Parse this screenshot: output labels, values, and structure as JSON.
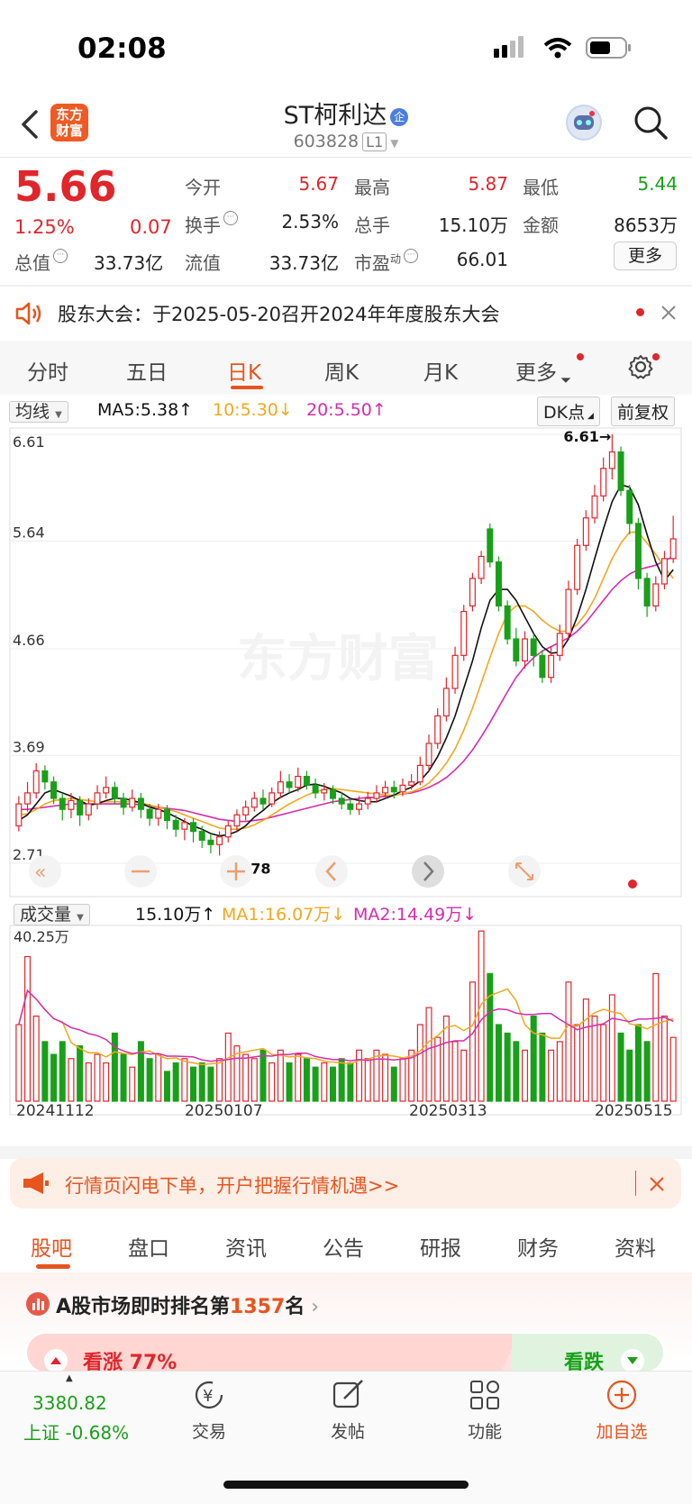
{
  "status": {
    "time": "02:08"
  },
  "header": {
    "logo_text": "东方财富",
    "title": "ST柯利达",
    "badge": "企",
    "code": "603828",
    "level": "L1"
  },
  "quote": {
    "price": "5.66",
    "change_pct": "1.25%",
    "change_val": "0.07",
    "open_label": "今开",
    "open": "5.67",
    "high_label": "最高",
    "high": "5.87",
    "low_label": "最低",
    "low": "5.44",
    "turnover_label": "换手",
    "turnover": "2.53%",
    "volume_label": "总手",
    "volume": "15.10万",
    "amount_label": "金额",
    "amount": "8653万",
    "mktcap_label": "总值",
    "mktcap": "33.73亿",
    "float_label": "流值",
    "float_cap": "33.73亿",
    "pe_label": "市盈",
    "pe_sup": "动",
    "pe": "66.01",
    "more_label": "更多"
  },
  "notice": {
    "text": "股东大会：于2025-05-20召开2024年年度股东大会"
  },
  "tabs": [
    "分时",
    "五日",
    "日K",
    "周K",
    "月K",
    "更多"
  ],
  "ma": {
    "select": "均线",
    "ma5": "MA5:5.38↑",
    "ma10": "10:5.30↓",
    "ma20": "20:5.50↑",
    "dk": "DK点",
    "fq": "前复权"
  },
  "vol_row": {
    "select": "成交量",
    "vol": "15.10万↑",
    "ma1": "MA1:16.07万↓",
    "ma2": "MA2:14.49万↓",
    "max_label": "40.25万"
  },
  "watermark": "东方财富",
  "chart_data": {
    "type": "candlestick",
    "y_ticks": [
      "6.61",
      "5.64",
      "4.66",
      "3.69",
      "2.71"
    ],
    "x_ticks": [
      "20241112",
      "20250107",
      "20250313",
      "20250515"
    ],
    "max_mark": "6.61→",
    "min_mark": "←2.78",
    "ylim": [
      2.71,
      6.61
    ],
    "candles": [
      [
        3.05,
        3.25,
        3.32,
        3.0
      ],
      [
        3.25,
        3.35,
        3.45,
        3.18
      ],
      [
        3.35,
        3.55,
        3.62,
        3.3
      ],
      [
        3.55,
        3.45,
        3.6,
        3.38
      ],
      [
        3.45,
        3.3,
        3.5,
        3.25
      ],
      [
        3.3,
        3.2,
        3.35,
        3.1
      ],
      [
        3.2,
        3.28,
        3.35,
        3.12
      ],
      [
        3.28,
        3.15,
        3.32,
        3.05
      ],
      [
        3.15,
        3.25,
        3.3,
        3.1
      ],
      [
        3.25,
        3.35,
        3.42,
        3.2
      ],
      [
        3.35,
        3.4,
        3.5,
        3.3
      ],
      [
        3.4,
        3.3,
        3.45,
        3.25
      ],
      [
        3.3,
        3.22,
        3.35,
        3.15
      ],
      [
        3.22,
        3.3,
        3.38,
        3.18
      ],
      [
        3.3,
        3.2,
        3.35,
        3.12
      ],
      [
        3.2,
        3.12,
        3.25,
        3.05
      ],
      [
        3.12,
        3.2,
        3.25,
        3.05
      ],
      [
        3.2,
        3.1,
        3.24,
        3.02
      ],
      [
        3.1,
        3.02,
        3.15,
        2.95
      ],
      [
        3.02,
        3.08,
        3.12,
        2.92
      ],
      [
        3.08,
        3.0,
        3.12,
        2.9
      ],
      [
        3.0,
        2.92,
        3.05,
        2.85
      ],
      [
        2.92,
        2.88,
        2.98,
        2.8
      ],
      [
        2.88,
        2.95,
        3.0,
        2.78
      ],
      [
        2.95,
        3.05,
        3.1,
        2.9
      ],
      [
        3.05,
        3.15,
        3.2,
        3.0
      ],
      [
        3.15,
        3.22,
        3.28,
        3.1
      ],
      [
        3.22,
        3.3,
        3.36,
        3.18
      ],
      [
        3.3,
        3.25,
        3.38,
        3.2
      ],
      [
        3.25,
        3.35,
        3.4,
        3.22
      ],
      [
        3.35,
        3.45,
        3.55,
        3.3
      ],
      [
        3.45,
        3.4,
        3.52,
        3.35
      ],
      [
        3.4,
        3.5,
        3.58,
        3.36
      ],
      [
        3.5,
        3.42,
        3.55,
        3.38
      ],
      [
        3.42,
        3.35,
        3.48,
        3.3
      ],
      [
        3.35,
        3.38,
        3.44,
        3.28
      ],
      [
        3.38,
        3.3,
        3.42,
        3.25
      ],
      [
        3.3,
        3.25,
        3.36,
        3.2
      ],
      [
        3.25,
        3.2,
        3.3,
        3.15
      ],
      [
        3.2,
        3.25,
        3.32,
        3.15
      ],
      [
        3.25,
        3.3,
        3.36,
        3.2
      ],
      [
        3.3,
        3.35,
        3.42,
        3.26
      ],
      [
        3.35,
        3.4,
        3.46,
        3.3
      ],
      [
        3.4,
        3.36,
        3.46,
        3.3
      ],
      [
        3.36,
        3.42,
        3.48,
        3.32
      ],
      [
        3.42,
        3.45,
        3.52,
        3.38
      ],
      [
        3.45,
        3.6,
        3.68,
        3.42
      ],
      [
        3.6,
        3.8,
        3.88,
        3.55
      ],
      [
        3.8,
        4.05,
        4.12,
        3.75
      ],
      [
        4.05,
        4.3,
        4.4,
        4.0
      ],
      [
        4.3,
        4.6,
        4.68,
        4.25
      ],
      [
        4.6,
        5.0,
        5.06,
        4.55
      ],
      [
        5.05,
        5.3,
        5.35,
        5.0
      ],
      [
        5.3,
        5.5,
        5.55,
        5.25
      ],
      [
        5.75,
        5.45,
        5.8,
        5.4
      ],
      [
        5.45,
        5.05,
        5.5,
        5.0
      ],
      [
        5.05,
        4.75,
        5.1,
        4.7
      ],
      [
        4.75,
        4.55,
        4.85,
        4.5
      ],
      [
        4.55,
        4.75,
        4.82,
        4.48
      ],
      [
        4.75,
        4.6,
        4.8,
        4.5
      ],
      [
        4.6,
        4.4,
        4.65,
        4.35
      ],
      [
        4.4,
        4.6,
        4.68,
        4.35
      ],
      [
        4.6,
        4.8,
        4.88,
        4.55
      ],
      [
        4.8,
        5.2,
        5.28,
        4.75
      ],
      [
        5.2,
        5.6,
        5.66,
        5.15
      ],
      [
        5.6,
        5.85,
        5.92,
        5.55
      ],
      [
        5.85,
        6.05,
        6.15,
        5.8
      ],
      [
        6.05,
        6.3,
        6.4,
        6.0
      ],
      [
        6.3,
        6.45,
        6.61,
        6.2
      ],
      [
        6.45,
        6.1,
        6.5,
        6.05
      ],
      [
        6.1,
        5.8,
        6.15,
        5.7
      ],
      [
        5.8,
        5.3,
        5.85,
        5.2
      ],
      [
        5.3,
        5.05,
        5.35,
        4.95
      ],
      [
        5.05,
        5.25,
        5.32,
        5.0
      ],
      [
        5.25,
        5.48,
        5.55,
        5.2
      ],
      [
        5.48,
        5.66,
        5.87,
        5.44
      ]
    ],
    "ma5": [
      3.1,
      3.15,
      3.25,
      3.35,
      3.38,
      3.35,
      3.32,
      3.28,
      3.24,
      3.25,
      3.28,
      3.3,
      3.3,
      3.28,
      3.26,
      3.22,
      3.2,
      3.17,
      3.13,
      3.09,
      3.05,
      3.02,
      2.98,
      2.96,
      2.97,
      3.0,
      3.05,
      3.13,
      3.19,
      3.26,
      3.31,
      3.35,
      3.38,
      3.42,
      3.43,
      3.41,
      3.38,
      3.35,
      3.3,
      3.28,
      3.27,
      3.27,
      3.3,
      3.33,
      3.37,
      3.4,
      3.46,
      3.55,
      3.68,
      3.85,
      4.05,
      4.3,
      4.55,
      4.85,
      5.1,
      5.2,
      5.2,
      5.1,
      4.95,
      4.8,
      4.68,
      4.62,
      4.63,
      4.75,
      4.95,
      5.2,
      5.48,
      5.75,
      6.0,
      6.15,
      6.13,
      5.97,
      5.7,
      5.45,
      5.28,
      5.38
    ],
    "ma10": [
      3.15,
      3.16,
      3.2,
      3.25,
      3.28,
      3.29,
      3.3,
      3.29,
      3.28,
      3.27,
      3.27,
      3.27,
      3.27,
      3.27,
      3.26,
      3.24,
      3.22,
      3.2,
      3.18,
      3.15,
      3.12,
      3.09,
      3.06,
      3.03,
      3.02,
      3.02,
      3.03,
      3.06,
      3.1,
      3.15,
      3.2,
      3.25,
      3.29,
      3.33,
      3.36,
      3.38,
      3.39,
      3.38,
      3.37,
      3.36,
      3.35,
      3.34,
      3.33,
      3.33,
      3.34,
      3.36,
      3.39,
      3.44,
      3.52,
      3.62,
      3.75,
      3.92,
      4.12,
      4.35,
      4.58,
      4.8,
      4.98,
      5.05,
      5.05,
      5.0,
      4.92,
      4.86,
      4.82,
      4.82,
      4.88,
      4.98,
      5.12,
      5.3,
      5.48,
      5.62,
      5.72,
      5.72,
      5.62,
      5.52,
      5.4,
      5.3
    ],
    "ma20": [
      3.2,
      3.2,
      3.21,
      3.22,
      3.23,
      3.24,
      3.25,
      3.25,
      3.25,
      3.25,
      3.25,
      3.25,
      3.25,
      3.25,
      3.24,
      3.23,
      3.22,
      3.21,
      3.2,
      3.19,
      3.17,
      3.15,
      3.13,
      3.11,
      3.1,
      3.09,
      3.09,
      3.1,
      3.11,
      3.13,
      3.15,
      3.17,
      3.19,
      3.21,
      3.23,
      3.25,
      3.27,
      3.28,
      3.29,
      3.3,
      3.31,
      3.31,
      3.32,
      3.33,
      3.34,
      3.35,
      3.37,
      3.4,
      3.44,
      3.49,
      3.56,
      3.64,
      3.74,
      3.86,
      3.99,
      4.13,
      4.27,
      4.4,
      4.5,
      4.58,
      4.64,
      4.68,
      4.72,
      4.76,
      4.82,
      4.9,
      5.0,
      5.1,
      5.2,
      5.28,
      5.34,
      5.38,
      5.4,
      5.42,
      5.46,
      5.5
    ],
    "volumes": [
      18,
      34,
      20,
      14,
      11,
      14,
      10,
      13,
      9,
      11,
      9,
      16,
      11,
      8,
      14,
      10,
      11,
      7,
      9,
      10,
      8,
      9,
      8,
      10,
      16,
      13,
      11,
      10,
      12,
      9,
      12,
      9,
      11,
      10,
      8,
      9,
      8,
      10,
      9,
      12,
      10,
      12,
      11,
      8,
      10,
      12,
      18,
      22,
      15,
      20,
      14,
      12,
      28,
      40,
      30,
      18,
      16,
      14,
      12,
      20,
      16,
      12,
      14,
      28,
      18,
      24,
      20,
      18,
      25,
      16,
      12,
      18,
      14,
      30,
      20,
      15
    ]
  },
  "ad": {
    "text": "行情页闪电下单，开户把握行情机遇>>"
  },
  "bottom_tabs": [
    "股吧",
    "盘口",
    "资讯",
    "公告",
    "研报",
    "财务",
    "资料"
  ],
  "rank": {
    "prefix": "A股市场即时排名第",
    "num": "1357",
    "suffix": "名"
  },
  "sentiment": {
    "up": "看涨 77%",
    "down": "看跌"
  },
  "nav": {
    "index_value": "3380.82",
    "index_name": "上证 -0.68%",
    "trade": "交易",
    "post": "发帖",
    "func": "功能",
    "add": "加自选"
  },
  "colors": {
    "up": "#e0252b",
    "down": "#19a019",
    "accent": "#e8541e",
    "ma10": "#f2a81d",
    "ma20": "#d52cad"
  }
}
